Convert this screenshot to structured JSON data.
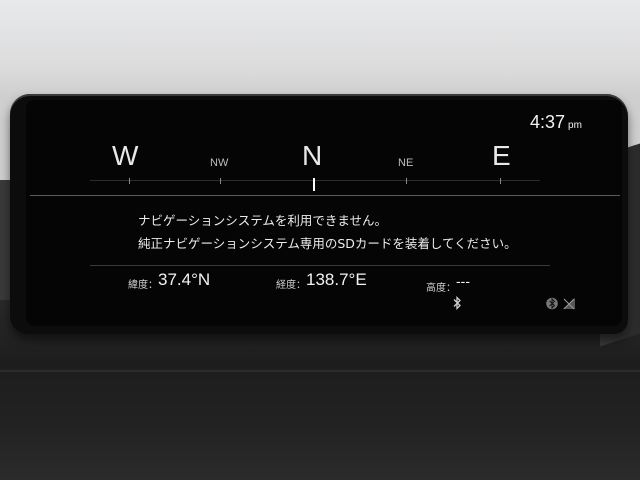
{
  "status": {
    "time": "4:37",
    "ampm": "pm"
  },
  "compass": {
    "west": "W",
    "northwest": "NW",
    "north": "N",
    "northeast": "NE",
    "east": "E"
  },
  "message": {
    "line1": "ナビゲーションシステムを利用できません。",
    "line2": "純正ナビゲーションシステム専用のSDカードを装着してください。"
  },
  "coords": {
    "latitude_label": "緯度：",
    "latitude_value": "37.4°N",
    "longitude_label": "経度：",
    "longitude_value": "138.7°E",
    "altitude_label": "高度：",
    "altitude_value": "---"
  },
  "icons": [
    "bluetooth-icon",
    "bluetooth-status-icon",
    "no-signal-icon"
  ],
  "colors": {
    "screen": "#050506",
    "text": "#ececec",
    "accent": "#ffffff"
  }
}
